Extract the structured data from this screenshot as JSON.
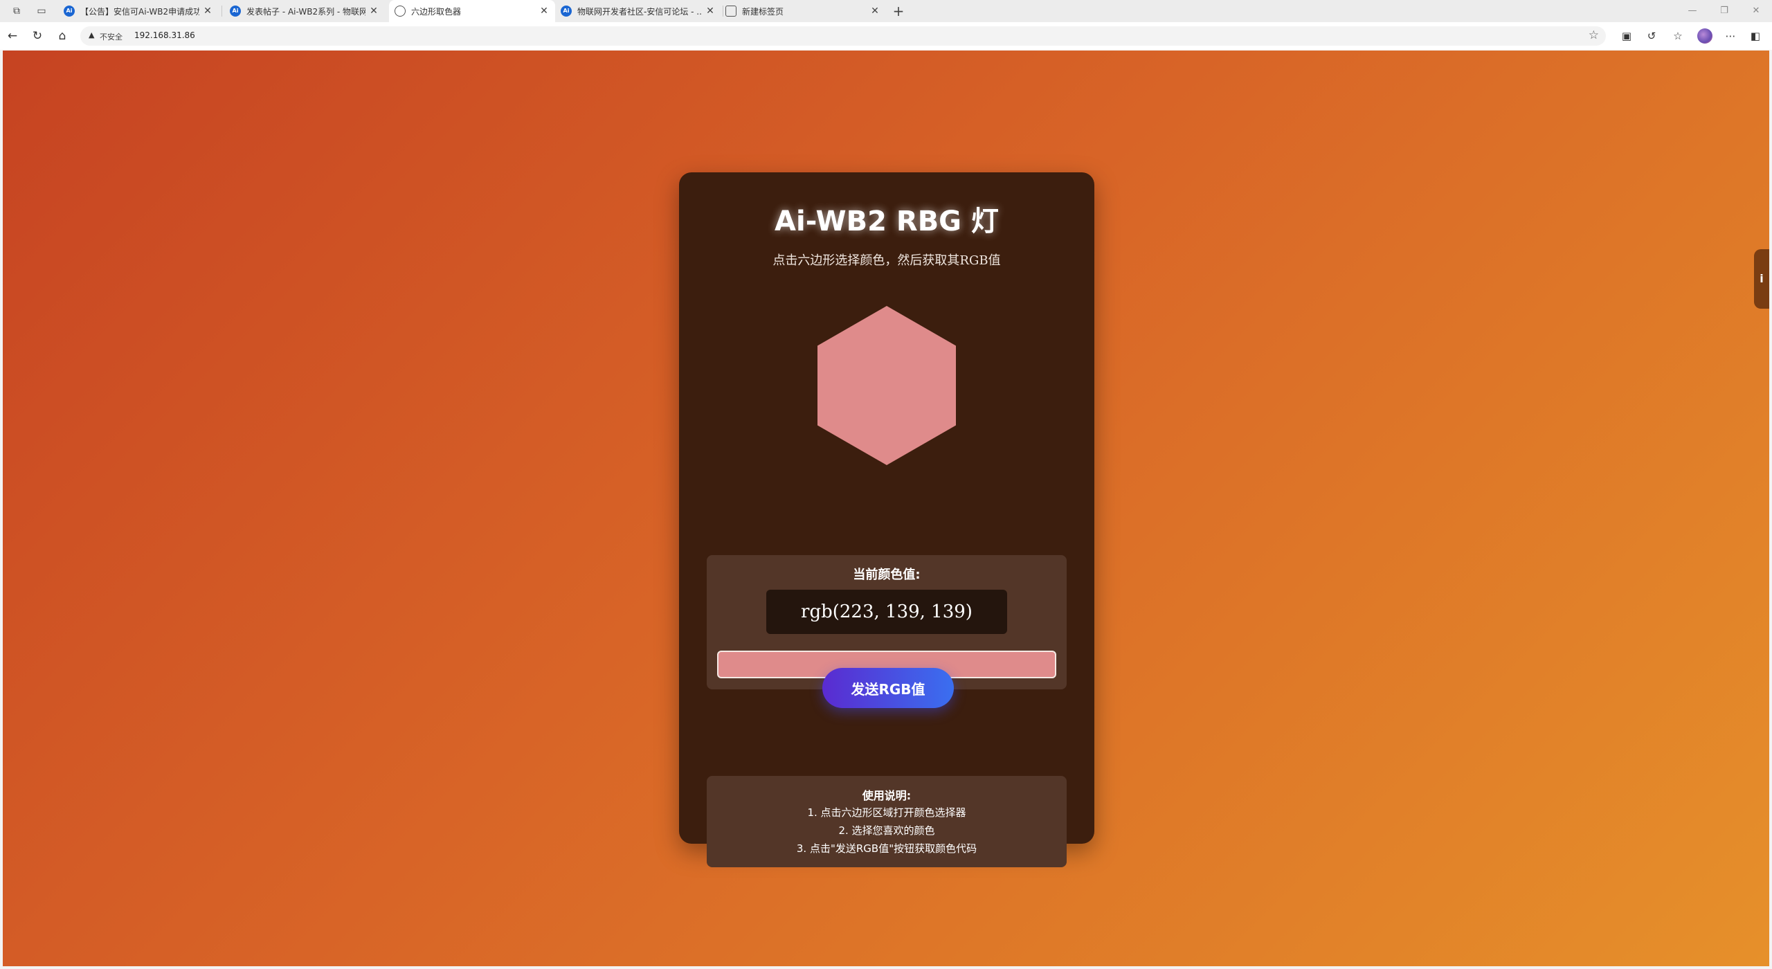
{
  "browser": {
    "tabs": [
      {
        "title": "【公告】安信可Ai-WB2申请成功...",
        "icon": "ai-thinker-favicon",
        "active": false
      },
      {
        "title": "发表帖子 - Ai-WB2系列 - 物联网...",
        "icon": "ai-thinker-favicon",
        "active": false
      },
      {
        "title": "六边形取色器",
        "icon": "globe-icon",
        "active": true
      },
      {
        "title": "物联网开发者社区-安信可论坛 - ...",
        "icon": "ai-thinker-favicon",
        "active": false
      },
      {
        "title": "新建标签页",
        "icon": "new-tab-page-icon",
        "active": false
      }
    ],
    "security_label": "不安全",
    "url": "192.168.31.86"
  },
  "page": {
    "title": "Ai-WB2 RBG 灯",
    "subtitle": "点击六边形选择颜色，然后获取其RGB值",
    "current_color_label": "当前颜色值:",
    "rgb_text": "rgb(223, 139, 139)",
    "selected_color": "#df8b8b",
    "send_button": "发送RGB值",
    "help_title": "使用说明:",
    "help_steps": [
      "1. 点击六边形区域打开颜色选择器",
      "2. 选择您喜欢的颜色",
      "3. 点击\"发送RGB值\"按钮获取颜色代码"
    ],
    "side_tab_icon": "info-icon"
  },
  "colors": {
    "card_bg": "#3c1e0e",
    "panel_bg": "#533628",
    "button_gradient": [
      "#5a2bd0",
      "#3a6ff0"
    ],
    "background_gradient": [
      "#c64322",
      "#e6902a"
    ]
  }
}
